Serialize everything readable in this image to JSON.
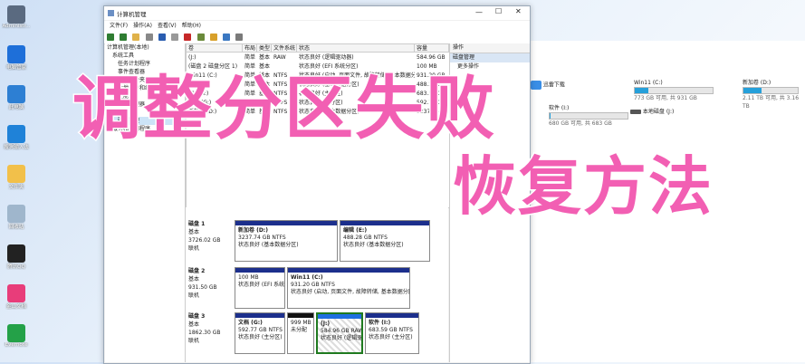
{
  "desktop_icons": [
    {
      "label": "Administr...",
      "color": "#5a6a80",
      "icon": "user-folder-icon"
    },
    {
      "label": "电脑管家",
      "color": "#1e6fd9",
      "icon": "pc-manager-icon"
    },
    {
      "label": "此电脑",
      "color": "#2d7fd3",
      "icon": "this-pc-icon"
    },
    {
      "label": "搜狗输入法",
      "color": "#1f82d8",
      "icon": "sogou-icon"
    },
    {
      "label": "文件夹",
      "color": "#f2c04a",
      "icon": "folder-icon"
    },
    {
      "label": "回收站",
      "color": "#9fb6cc",
      "icon": "recycle-bin-icon"
    },
    {
      "label": "腾讯QQ",
      "color": "#222222",
      "icon": "qq-icon"
    },
    {
      "label": "金山文档",
      "color": "#e83d7a",
      "icon": "kdocs-icon"
    },
    {
      "label": "Evernote",
      "color": "#24a148",
      "icon": "evernote-icon"
    }
  ],
  "window": {
    "title": "计算机管理",
    "menus": [
      "文件(F)",
      "操作(A)",
      "查看(V)",
      "帮助(H)"
    ]
  },
  "tree": {
    "items": [
      "计算机管理(本地)",
      "系统工具",
      "任务计划程序",
      "事件查看器",
      "共享文件夹",
      "本地用户和组",
      "性能",
      "设备管理器",
      "存储",
      "磁盘管理",
      "服务和应用程序"
    ]
  },
  "volume_table": {
    "headers": [
      "卷",
      "布局",
      "类型",
      "文件系统",
      "状态",
      "容量"
    ],
    "rows": [
      [
        "(J:)",
        "简单",
        "基本",
        "RAW",
        "状态良好 (逻辑驱动器)",
        "584.96 GB"
      ],
      [
        "(磁盘 2 磁盘分区 1)",
        "简单",
        "基本",
        "",
        "状态良好 (EFI 系统分区)",
        "100 MB"
      ],
      [
        "Win11 (C:)",
        "简单",
        "基本",
        "NTFS",
        "状态良好 (启动, 页面文件, 故障转储, 基本数据分区)",
        "931.20 GB"
      ],
      [
        "编辑 (E:)",
        "简单",
        "基本",
        "NTFS",
        "状态良好 (基本数据分区)",
        "488.28 GB"
      ],
      [
        "软件 (I:)",
        "简单",
        "基本",
        "NTFS",
        "状态良好 (主分区)",
        "683.59 GB"
      ],
      [
        "文档 (G:)",
        "简单",
        "基本",
        "NTFS",
        "状态良好 (主分区)",
        "592.77 GB"
      ],
      [
        "新加卷 (D:)",
        "简单",
        "基本",
        "NTFS",
        "状态良好 (基本数据分区)",
        "3237.74 GB"
      ]
    ]
  },
  "actions": {
    "header": "操作",
    "section": "磁盘管理",
    "more": "更多操作"
  },
  "disks": [
    {
      "name": "磁盘 1",
      "type": "基本",
      "size": "3726.02 GB",
      "status": "联机",
      "parts": [
        {
          "name": "新加卷 (D:)",
          "size": "3237.74 GB NTFS",
          "status": "状态良好 (基本数据分区)"
        },
        {
          "name": "编辑 (E:)",
          "size": "488.28 GB NTFS",
          "status": "状态良好 (基本数据分区)"
        }
      ]
    },
    {
      "name": "磁盘 2",
      "type": "基本",
      "size": "931.50 GB",
      "status": "联机",
      "parts": [
        {
          "name": "",
          "size": "100 MB",
          "status": "状态良好 (EFI 系统分"
        },
        {
          "name": "Win11 (C:)",
          "size": "931.20 GB NTFS",
          "status": "状态良好 (启动, 页面文件, 故障转储, 基本数据分区)"
        }
      ]
    },
    {
      "name": "磁盘 3",
      "type": "基本",
      "size": "1862.30 GB",
      "status": "联机",
      "parts": [
        {
          "name": "文档 (G:)",
          "size": "592.77 GB NTFS",
          "status": "状态良好 (主分区)"
        },
        {
          "name": "",
          "size": "999 MB",
          "status": "未分配"
        },
        {
          "name": "(J:)",
          "size": "584.96 GB RAW",
          "status": "状态良好 (逻辑驱动"
        },
        {
          "name": "软件 (I:)",
          "size": "683.59 GB NTFS",
          "status": "状态良好 (主分区)"
        }
      ]
    }
  ],
  "explorer": {
    "drives": [
      {
        "name": "迅雷下载",
        "detail": "",
        "fill": 0
      },
      {
        "name": "Win11 (C:)",
        "detail": "773 GB 可用, 共 931 GB",
        "fill": 0.17
      },
      {
        "name": "新加卷 (D:)",
        "detail": "2.11 TB 可用, 共 3.16 TB",
        "fill": 0.33
      },
      {
        "name": "软件 (I:)",
        "detail": "680 GB 可用, 共 683 GB",
        "fill": 0.01
      },
      {
        "name": "本地磁盘 (J:)",
        "detail": "",
        "fill": 0
      }
    ]
  },
  "overlay": {
    "line1": "调整分区失败",
    "line2": "恢复方法"
  }
}
